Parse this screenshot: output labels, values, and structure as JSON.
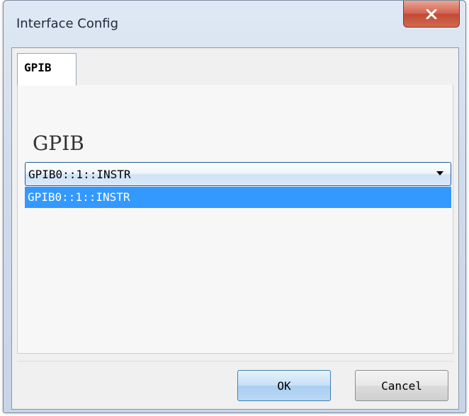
{
  "window": {
    "title": "Interface Config"
  },
  "tabs": [
    {
      "label": "GPIB",
      "active": true
    }
  ],
  "panel": {
    "section_label": "GPIB",
    "combo": {
      "selected_value": "GPIB0::1::INSTR",
      "options": [
        "GPIB0::1::INSTR"
      ]
    }
  },
  "buttons": {
    "ok_label": "OK",
    "cancel_label": "Cancel"
  },
  "colors": {
    "selection": "#3399ff",
    "close_button": "#c24a36",
    "combo_border": "#1e5a9e"
  },
  "icons": {
    "close": "close-x-icon",
    "dropdown": "chevron-down-icon"
  }
}
